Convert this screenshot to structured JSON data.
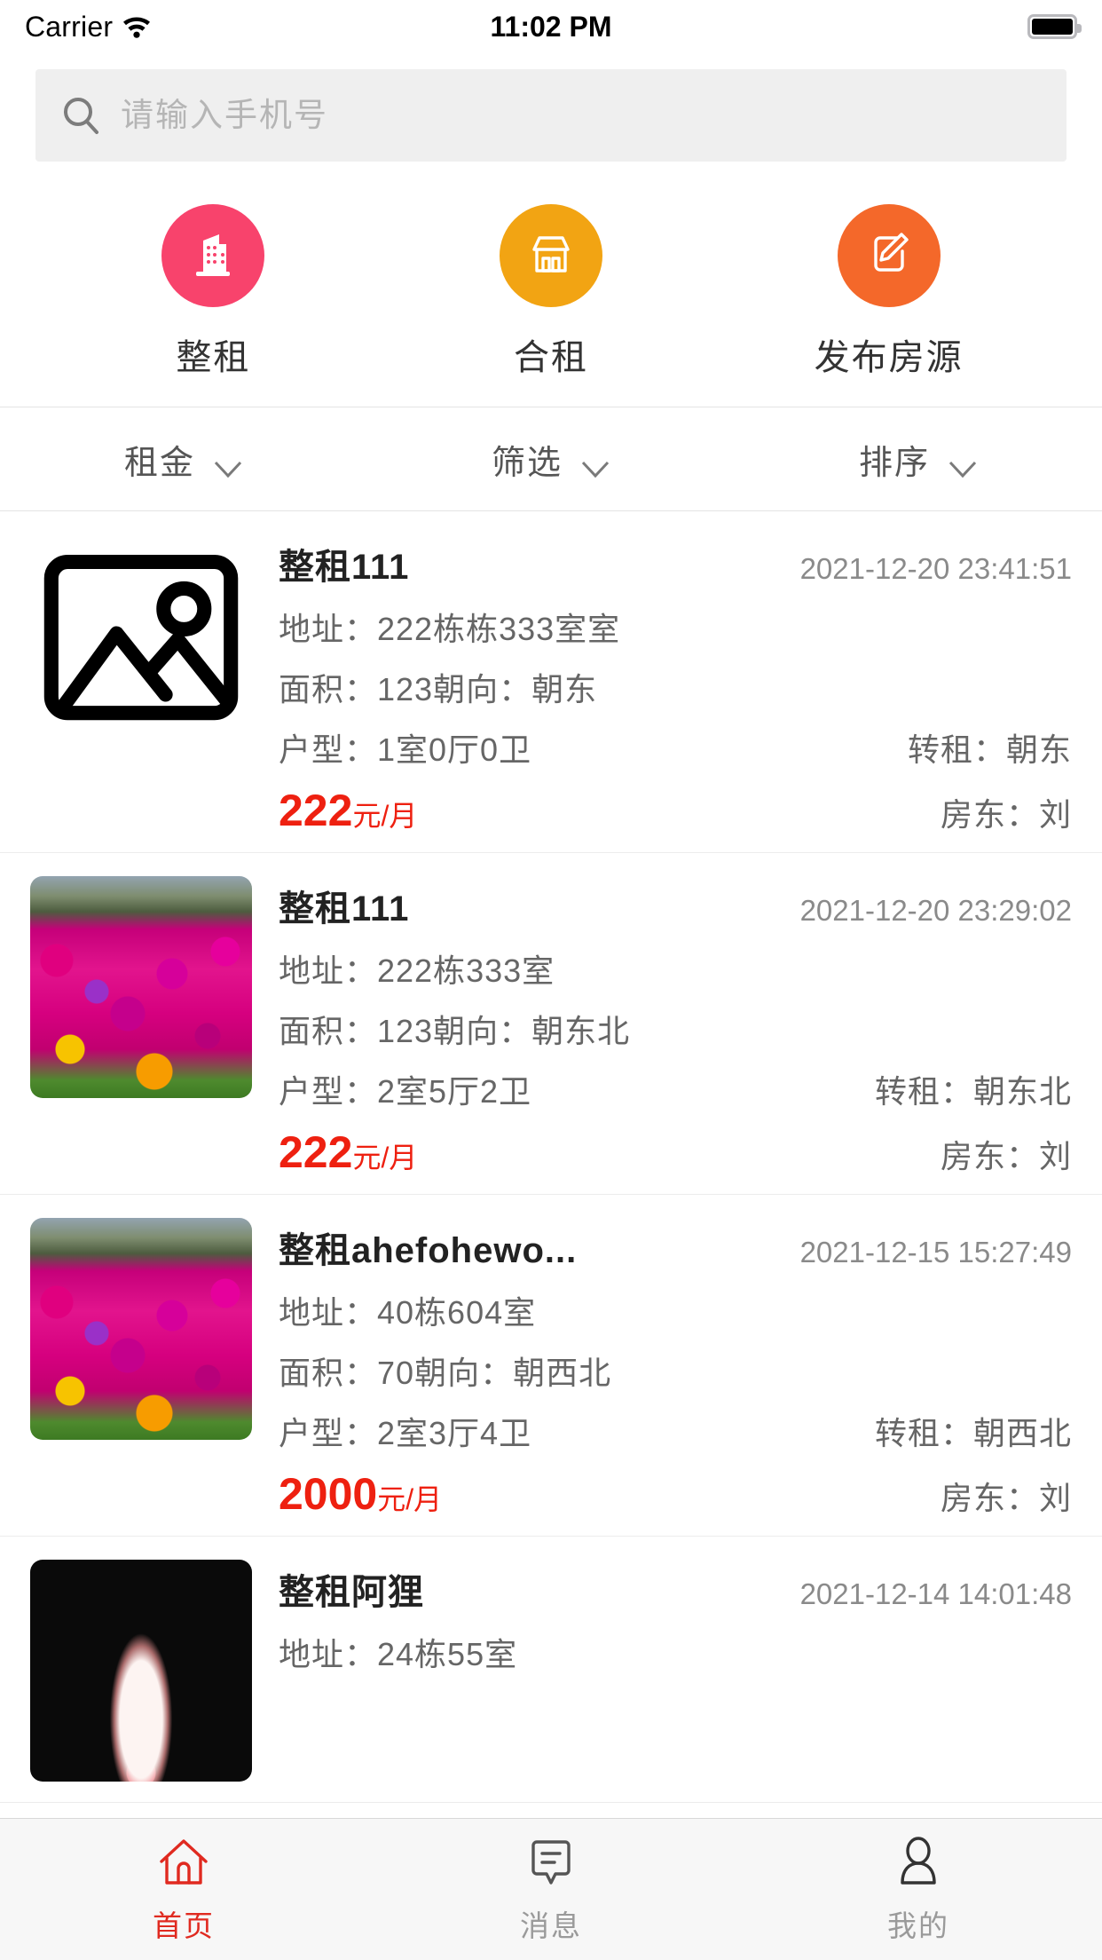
{
  "status_bar": {
    "carrier": "Carrier",
    "wifi_icon": "wifi-icon",
    "time": "11:02 PM",
    "battery_icon": "battery-full-icon"
  },
  "search": {
    "icon": "search-icon",
    "placeholder": "请输入手机号",
    "value": ""
  },
  "quick_actions": [
    {
      "label": "整租",
      "icon": "building-icon",
      "color": "#F8436C"
    },
    {
      "label": "合租",
      "icon": "shop-icon",
      "color": "#F2A413"
    },
    {
      "label": "发布房源",
      "icon": "edit-post-icon",
      "color": "#F4682A"
    }
  ],
  "filters": [
    {
      "label": "租金",
      "icon": "chevron-down-icon"
    },
    {
      "label": "筛选",
      "icon": "chevron-down-icon"
    },
    {
      "label": "排序",
      "icon": "chevron-down-icon"
    }
  ],
  "labels": {
    "address": "地址：",
    "area": "面积：",
    "orientation": "朝向：",
    "layout": "户型：",
    "sublet": "转租：",
    "landlord": "房东："
  },
  "listings": [
    {
      "title": "整租111",
      "time": "2021-12-20 23:41:51",
      "address": "222栋栋333室室",
      "area": "123",
      "orientation": "朝东",
      "layout": "1室0厅0卫",
      "sublet": "朝东",
      "price": "222",
      "price_unit": "元/月",
      "landlord": "刘",
      "thumb_kind": "placeholder"
    },
    {
      "title": "整租111",
      "time": "2021-12-20 23:29:02",
      "address": "222栋333室",
      "area": "123",
      "orientation": "朝东北",
      "layout": "2室5厅2卫",
      "sublet": "朝东北",
      "price": "222",
      "price_unit": "元/月",
      "landlord": "刘",
      "thumb_kind": "flowers"
    },
    {
      "title": "整租ahefohewo...",
      "time": "2021-12-15 15:27:49",
      "address": "40栋604室",
      "area": "70",
      "orientation": "朝西北",
      "layout": "2室3厅4卫",
      "sublet": "朝西北",
      "price": "2000",
      "price_unit": "元/月",
      "landlord": "刘",
      "thumb_kind": "flowers"
    },
    {
      "title": "整租阿狸",
      "time": "2021-12-14 14:01:48",
      "address": "24栋55室",
      "area": "",
      "orientation": "",
      "layout": "",
      "sublet": "",
      "price": "",
      "price_unit": "",
      "landlord": "",
      "thumb_kind": "dark"
    }
  ],
  "tabs": [
    {
      "label": "首页",
      "icon": "home-icon",
      "active": true
    },
    {
      "label": "消息",
      "icon": "message-icon",
      "active": false
    },
    {
      "label": "我的",
      "icon": "person-icon",
      "active": false
    }
  ]
}
